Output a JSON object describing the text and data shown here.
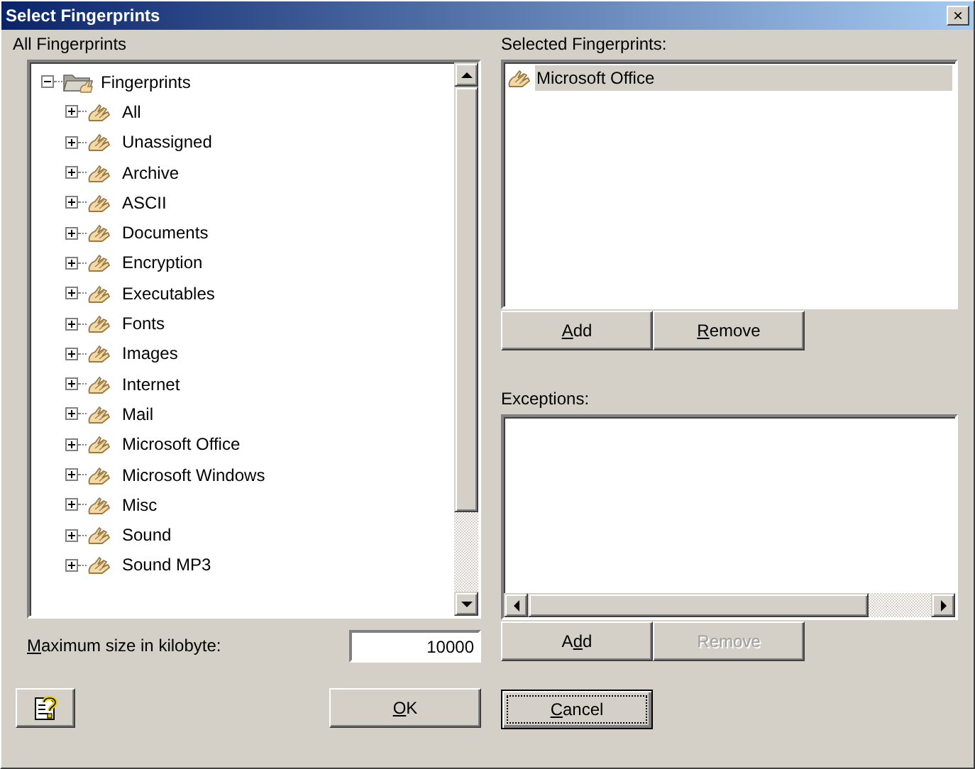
{
  "window": {
    "title": "Select Fingerprints",
    "close": "×"
  },
  "all_fingerprints": {
    "label": "All Fingerprints",
    "tree": [
      {
        "label": "Fingerprints",
        "expanded": true,
        "children": [
          {
            "label": "All",
            "expanded": false
          },
          {
            "label": "Unassigned",
            "expanded": false
          },
          {
            "label": "Archive",
            "expanded": false
          },
          {
            "label": "ASCII",
            "expanded": false
          },
          {
            "label": "Documents",
            "expanded": false
          },
          {
            "label": "Encryption",
            "expanded": false
          },
          {
            "label": "Executables",
            "expanded": false
          },
          {
            "label": "Fonts",
            "expanded": false
          },
          {
            "label": "Images",
            "expanded": false
          },
          {
            "label": "Internet",
            "expanded": false
          },
          {
            "label": "Mail",
            "expanded": false
          },
          {
            "label": "Microsoft Office",
            "expanded": false
          },
          {
            "label": "Microsoft Windows",
            "expanded": false
          },
          {
            "label": "Misc",
            "expanded": false
          },
          {
            "label": "Sound",
            "expanded": false
          },
          {
            "label": "Sound MP3",
            "expanded": false
          }
        ]
      }
    ]
  },
  "max_size": {
    "label": [
      {
        "text": "M",
        "underlined": true
      },
      {
        "text": "aximum size in kilobyte:",
        "underlined": false
      }
    ],
    "value": "10000"
  },
  "selected_fingerprints": {
    "label": "Selected Fingerprints:",
    "items": [
      {
        "label": "Microsoft Office",
        "selected": true
      }
    ],
    "buttons": [
      {
        "label": [
          {
            "text": "A",
            "underlined": true
          },
          {
            "text": "dd",
            "underlined": false
          }
        ],
        "disabled": false
      },
      {
        "label": [
          {
            "text": "R",
            "underlined": true
          },
          {
            "text": "emove",
            "underlined": false
          }
        ],
        "disabled": false
      }
    ]
  },
  "exceptions": {
    "label": "Exceptions:",
    "buttons": [
      {
        "label": [
          {
            "text": "A",
            "underlined": false
          },
          {
            "text": "d",
            "underlined": true
          },
          {
            "text": "d",
            "underlined": false
          }
        ],
        "disabled": false
      },
      {
        "label": [
          {
            "text": "Remove",
            "underlined": false
          }
        ],
        "disabled": true
      }
    ]
  },
  "footer": {
    "ok": {
      "label": [
        {
          "text": "O",
          "underlined": true
        },
        {
          "text": "K",
          "underlined": false
        }
      ]
    },
    "cancel": {
      "label": [
        {
          "text": "C",
          "underlined": true
        },
        {
          "text": "ancel",
          "underlined": false
        }
      ],
      "focused": true
    }
  }
}
